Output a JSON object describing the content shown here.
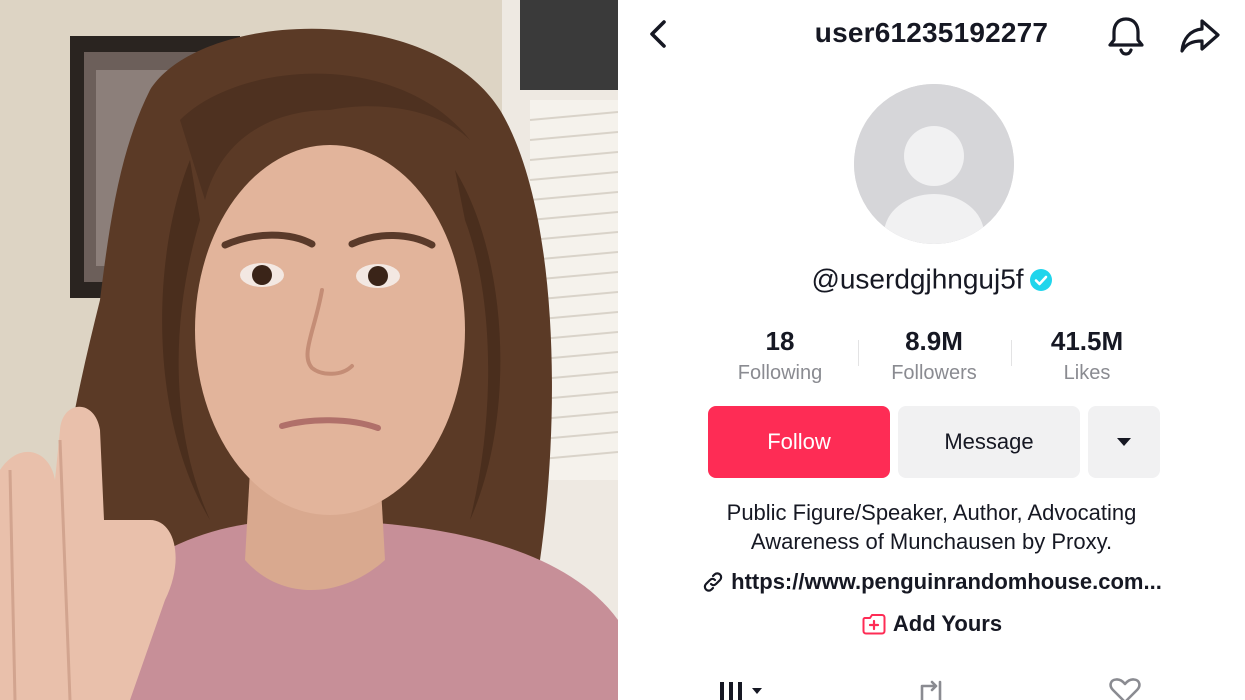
{
  "header": {
    "username": "user61235192277",
    "back_icon": "chevron-left-icon",
    "bell_icon": "bell-icon",
    "share_icon": "share-arrow-icon"
  },
  "profile": {
    "handle": "@userdgjhnguj5f",
    "verified": true,
    "avatar_icon": "default-avatar-icon"
  },
  "stats": [
    {
      "value": "18",
      "label": "Following"
    },
    {
      "value": "8.9M",
      "label": "Followers"
    },
    {
      "value": "41.5M",
      "label": "Likes"
    }
  ],
  "actions": {
    "follow_label": "Follow",
    "message_label": "Message",
    "more_icon": "caret-down-icon"
  },
  "bio": {
    "line1": "Public Figure/Speaker, Author, Advocating",
    "line2": "Awareness of Munchausen by Proxy."
  },
  "link": {
    "text": "https://www.penguinrandomhouse.com...",
    "icon": "link-icon"
  },
  "add_yours": {
    "label": "Add Yours",
    "icon": "add-yours-icon"
  },
  "tabs": [
    {
      "name": "videos-grid",
      "icon": "grid-icon"
    },
    {
      "name": "reposts",
      "icon": "repost-icon"
    },
    {
      "name": "liked",
      "icon": "heart-icon"
    }
  ],
  "colors": {
    "accent": "#fe2c55",
    "verified": "#20d5ec",
    "secondary_button": "#f1f1f2",
    "muted_text": "#8a8b91"
  }
}
